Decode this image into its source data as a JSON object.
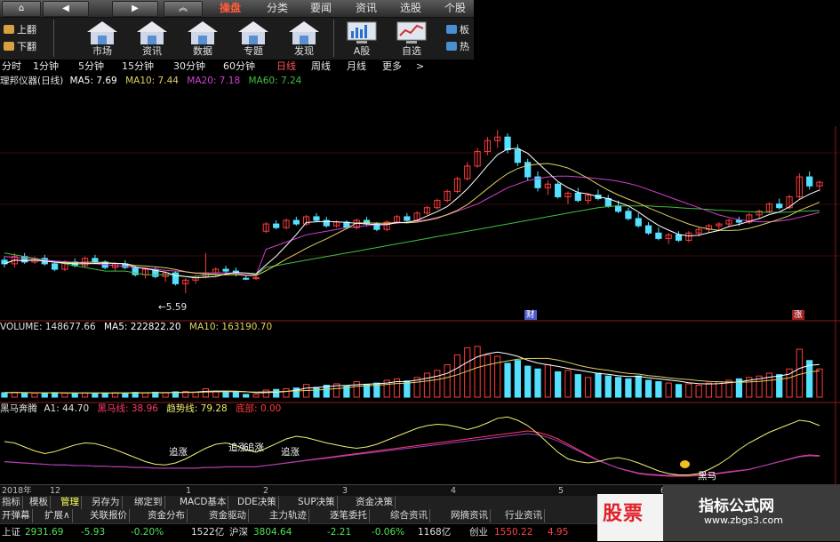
{
  "colors": {
    "up": "#ff3b3b",
    "down": "#55e0ff",
    "ma5": "#ffffff",
    "ma10": "#e0d060",
    "ma20": "#d040d0",
    "ma60": "#40c040",
    "yellow": "#f0f070",
    "brand": "#e0202a"
  },
  "nav": {
    "home_icon": "house-icon",
    "back_icon": "triangle-left-icon",
    "forward_icon": "triangle-right-icon",
    "up_icon": "double-chevron-up-icon"
  },
  "menu": [
    {
      "label": "操盘",
      "active": true
    },
    {
      "label": "分类"
    },
    {
      "label": "要闻"
    },
    {
      "label": "资讯"
    },
    {
      "label": "选股"
    },
    {
      "label": "个股"
    }
  ],
  "paging": {
    "prev": "上翻",
    "next": "下翻"
  },
  "tools": [
    "市场",
    "资讯",
    "数据",
    "专题",
    "发现",
    "A股",
    "自选"
  ],
  "side_tools": [
    "板",
    "热"
  ],
  "periods": [
    {
      "label": "分时"
    },
    {
      "label": "1分钟"
    },
    {
      "label": "5分钟"
    },
    {
      "label": "15分钟"
    },
    {
      "label": "30分钟"
    },
    {
      "label": "60分钟"
    },
    {
      "label": "日线",
      "active": true
    },
    {
      "label": "周线"
    },
    {
      "label": "月线"
    },
    {
      "label": "更多"
    },
    {
      "label": ">"
    }
  ],
  "main_readout": {
    "name": "理邦仪器(日线)",
    "ma5": "MA5: 7.69",
    "ma10": "MA10: 7.44",
    "ma20": "MA20: 7.18",
    "ma60": "MA60: 7.24",
    "low_label": "←5.59"
  },
  "volume_readout": {
    "volume": "VOLUME: 148677.66",
    "ma5": "MA5: 222822.20",
    "ma10": "MA10: 163190.70"
  },
  "indicator_readout": {
    "name": "黑马奔腾",
    "a1": "A1: 44.70",
    "hm": "黑马线: 38.96",
    "trend": "趋势线: 79.28",
    "bottom": "底部: 0.00"
  },
  "chart_labels": {
    "zhuizhang": "追涨",
    "heima": "黑马",
    "cai": "财",
    "zhang": "涨"
  },
  "dates": [
    "2018年",
    "12",
    "1",
    "2",
    "3",
    "4",
    "5",
    "6"
  ],
  "tabs_row1": [
    "指标",
    "模板",
    "管理",
    "另存为",
    "绑定到",
    "MACD基本",
    "DDE决策",
    "SUP决策",
    "资金决策"
  ],
  "tabs_row2": [
    "开弹幕",
    "扩展∧",
    "关联报价",
    "资金分布",
    "资金驱动",
    "主力轨迹",
    "逐笔委托",
    "综合资讯",
    "网摘资讯",
    "行业资讯"
  ],
  "status": {
    "sh_label": "上证",
    "sh_value": "2931.69",
    "sh_change": "-5.93",
    "sh_pct": "-0.20%",
    "sh_amount": "1522亿",
    "hs_label": "沪深",
    "hs_value": "3804.64",
    "hs_change": "-2.21",
    "hs_pct": "-0.06%",
    "hs_amount": "1168亿",
    "cy_label": "创业",
    "cy_value": "1550.22",
    "cy_change": "4.95"
  },
  "logo": {
    "text": "股票"
  },
  "watermark": {
    "title": "指标公式网",
    "url": "www.zbgs3.com"
  },
  "chart_data": {
    "type": "candlestick",
    "price_range": [
      5.0,
      10.2
    ],
    "volume_range": [
      0,
      460000
    ],
    "indicator_range": [
      0,
      100
    ],
    "candles": [
      [
        6.5,
        6.6,
        6.3,
        6.4
      ],
      [
        6.4,
        6.7,
        6.3,
        6.6
      ],
      [
        6.6,
        6.7,
        6.4,
        6.45
      ],
      [
        6.45,
        6.6,
        6.4,
        6.55
      ],
      [
        6.55,
        6.65,
        6.35,
        6.4
      ],
      [
        6.4,
        6.45,
        6.2,
        6.25
      ],
      [
        6.25,
        6.5,
        6.2,
        6.45
      ],
      [
        6.45,
        6.55,
        6.3,
        6.35
      ],
      [
        6.35,
        6.6,
        6.3,
        6.55
      ],
      [
        6.55,
        6.65,
        6.4,
        6.45
      ],
      [
        6.45,
        6.5,
        6.25,
        6.3
      ],
      [
        6.3,
        6.45,
        6.2,
        6.4
      ],
      [
        6.4,
        6.5,
        6.25,
        6.3
      ],
      [
        6.3,
        6.35,
        6.05,
        6.1
      ],
      [
        6.1,
        6.3,
        6.0,
        6.25
      ],
      [
        6.25,
        6.3,
        6.0,
        6.05
      ],
      [
        6.05,
        6.2,
        5.9,
        6.15
      ],
      [
        6.15,
        6.2,
        5.8,
        5.85
      ],
      [
        5.85,
        6.0,
        5.59,
        5.95
      ],
      [
        5.95,
        6.1,
        5.85,
        6.05
      ],
      [
        6.05,
        6.7,
        6.0,
        6.15
      ],
      [
        6.15,
        6.3,
        6.05,
        6.25
      ],
      [
        6.25,
        6.35,
        6.1,
        6.2
      ],
      [
        6.2,
        6.3,
        6.05,
        6.15
      ],
      [
        6.0,
        6.1,
        5.95,
        5.98
      ],
      [
        5.99,
        6.05,
        5.95,
        6.02
      ],
      [
        7.3,
        7.55,
        7.25,
        7.5
      ],
      [
        7.5,
        7.6,
        7.35,
        7.4
      ],
      [
        7.4,
        7.65,
        7.35,
        7.6
      ],
      [
        7.6,
        7.7,
        7.45,
        7.5
      ],
      [
        7.5,
        7.75,
        7.45,
        7.7
      ],
      [
        7.7,
        7.8,
        7.55,
        7.6
      ],
      [
        7.6,
        7.7,
        7.4,
        7.45
      ],
      [
        7.45,
        7.6,
        7.4,
        7.55
      ],
      [
        7.55,
        7.6,
        7.35,
        7.4
      ],
      [
        7.4,
        7.65,
        7.35,
        7.6
      ],
      [
        7.6,
        7.7,
        7.45,
        7.5
      ],
      [
        7.5,
        7.55,
        7.3,
        7.35
      ],
      [
        7.35,
        7.6,
        7.3,
        7.55
      ],
      [
        7.55,
        7.75,
        7.5,
        7.7
      ],
      [
        7.7,
        7.8,
        7.55,
        7.6
      ],
      [
        7.6,
        7.85,
        7.55,
        7.8
      ],
      [
        7.8,
        8.0,
        7.75,
        7.95
      ],
      [
        7.95,
        8.2,
        7.9,
        8.15
      ],
      [
        8.15,
        8.45,
        8.1,
        8.4
      ],
      [
        8.4,
        8.8,
        8.35,
        8.75
      ],
      [
        8.75,
        9.2,
        8.7,
        9.1
      ],
      [
        9.1,
        9.6,
        9.05,
        9.5
      ],
      [
        9.5,
        9.9,
        9.4,
        9.8
      ],
      [
        9.8,
        10.1,
        9.6,
        9.9
      ],
      [
        9.9,
        10.0,
        9.45,
        9.55
      ],
      [
        9.55,
        9.7,
        9.1,
        9.2
      ],
      [
        9.2,
        9.3,
        8.7,
        8.8
      ],
      [
        8.8,
        8.95,
        8.4,
        8.5
      ],
      [
        8.5,
        8.7,
        8.3,
        8.6
      ],
      [
        8.6,
        8.65,
        8.2,
        8.25
      ],
      [
        8.25,
        8.4,
        8.05,
        8.35
      ],
      [
        8.35,
        8.5,
        8.1,
        8.15
      ],
      [
        8.15,
        8.35,
        8.05,
        8.3
      ],
      [
        8.3,
        8.45,
        8.15,
        8.2
      ],
      [
        8.2,
        8.3,
        7.95,
        8.0
      ],
      [
        8.0,
        8.15,
        7.8,
        7.85
      ],
      [
        7.85,
        7.95,
        7.6,
        7.65
      ],
      [
        7.65,
        7.8,
        7.4,
        7.45
      ],
      [
        7.45,
        7.55,
        7.2,
        7.25
      ],
      [
        7.25,
        7.4,
        7.05,
        7.1
      ],
      [
        7.1,
        7.25,
        6.95,
        7.2
      ],
      [
        7.2,
        7.3,
        7.0,
        7.05
      ],
      [
        7.05,
        7.3,
        7.0,
        7.25
      ],
      [
        7.25,
        7.4,
        7.15,
        7.35
      ],
      [
        7.35,
        7.5,
        7.25,
        7.45
      ],
      [
        7.45,
        7.55,
        7.3,
        7.5
      ],
      [
        7.5,
        7.65,
        7.4,
        7.6
      ],
      [
        7.6,
        7.7,
        7.45,
        7.55
      ],
      [
        7.55,
        7.8,
        7.5,
        7.75
      ],
      [
        7.75,
        7.9,
        7.65,
        7.85
      ],
      [
        7.85,
        8.1,
        7.8,
        8.05
      ],
      [
        8.05,
        8.2,
        7.9,
        7.95
      ],
      [
        7.95,
        8.3,
        7.9,
        8.25
      ],
      [
        8.25,
        8.9,
        8.2,
        8.8
      ],
      [
        8.8,
        8.95,
        8.45,
        8.55
      ],
      [
        8.55,
        8.7,
        8.4,
        8.65
      ]
    ],
    "volumes": [
      32000,
      35000,
      30000,
      28000,
      30000,
      33000,
      29000,
      27000,
      31000,
      28000,
      30000,
      32000,
      29000,
      34000,
      31000,
      35000,
      33000,
      38000,
      40000,
      36000,
      60000,
      42000,
      38000,
      35000,
      20000,
      18000,
      50000,
      55000,
      60000,
      65000,
      90000,
      70000,
      85000,
      95000,
      80000,
      110000,
      90000,
      100000,
      120000,
      130000,
      115000,
      140000,
      170000,
      190000,
      230000,
      300000,
      350000,
      360000,
      300000,
      290000,
      240000,
      260000,
      220000,
      200000,
      230000,
      180000,
      190000,
      160000,
      140000,
      170000,
      150000,
      140000,
      130000,
      150000,
      120000,
      110000,
      100000,
      90000,
      95000,
      85000,
      100000,
      110000,
      120000,
      130000,
      140000,
      150000,
      170000,
      160000,
      200000,
      340000,
      260000,
      200000
    ],
    "ma60": [
      6.7,
      6.65,
      6.6,
      6.55,
      6.5,
      6.45,
      6.4,
      6.35,
      6.3,
      6.25,
      6.2,
      6.2,
      6.2,
      6.15,
      6.1,
      6.1,
      6.1,
      6.1,
      6.05,
      6.05,
      6.1,
      6.1,
      6.1,
      6.1,
      6.1,
      6.1,
      6.3,
      6.35,
      6.4,
      6.45,
      6.5,
      6.55,
      6.6,
      6.65,
      6.7,
      6.75,
      6.8,
      6.85,
      6.9,
      6.95,
      7.0,
      7.05,
      7.1,
      7.15,
      7.2,
      7.25,
      7.3,
      7.35,
      7.4,
      7.45,
      7.5,
      7.55,
      7.6,
      7.65,
      7.7,
      7.75,
      7.8,
      7.85,
      7.9,
      7.95,
      7.98,
      8.0,
      8.0,
      8.0,
      8.0,
      7.98,
      7.97,
      7.95,
      7.93,
      7.92,
      7.9,
      7.88,
      7.87,
      7.85,
      7.84,
      7.83,
      7.82,
      7.82,
      7.83,
      7.85,
      7.86,
      7.87
    ],
    "ma20": [
      6.6,
      6.58,
      6.55,
      6.52,
      6.5,
      6.48,
      6.46,
      6.44,
      6.42,
      6.4,
      6.38,
      6.35,
      6.33,
      6.3,
      6.28,
      6.25,
      6.22,
      6.2,
      6.18,
      6.15,
      6.15,
      6.15,
      6.15,
      6.14,
      6.1,
      6.08,
      6.8,
      6.9,
      7.0,
      7.1,
      7.2,
      7.25,
      7.3,
      7.35,
      7.4,
      7.42,
      7.45,
      7.48,
      7.5,
      7.52,
      7.55,
      7.58,
      7.62,
      7.68,
      7.75,
      7.85,
      7.95,
      8.05,
      8.2,
      8.35,
      8.5,
      8.6,
      8.7,
      8.75,
      8.8,
      8.82,
      8.82,
      8.8,
      8.78,
      8.75,
      8.72,
      8.68,
      8.62,
      8.55,
      8.45,
      8.35,
      8.25,
      8.15,
      8.05,
      7.95,
      7.85,
      7.75,
      7.68,
      7.62,
      7.58,
      7.56,
      7.56,
      7.58,
      7.62,
      7.68,
      7.75,
      7.82
    ],
    "indicator": {
      "trend": [
        60,
        58,
        52,
        46,
        42,
        45,
        50,
        55,
        58,
        57,
        53,
        48,
        42,
        36,
        30,
        26,
        25,
        28,
        34,
        42,
        50,
        56,
        58,
        54,
        48,
        44,
        50,
        57,
        64,
        68,
        66,
        62,
        58,
        55,
        52,
        50,
        52,
        56,
        62,
        68,
        74,
        80,
        84,
        86,
        85,
        82,
        78,
        82,
        88,
        95,
        97,
        92,
        84,
        72,
        58,
        44,
        34,
        30,
        28,
        30,
        34,
        36,
        33,
        28,
        22,
        16,
        12,
        10,
        10,
        12,
        18,
        26,
        36,
        48,
        58,
        66,
        74,
        80,
        86,
        92,
        90,
        84
      ],
      "hm": [
        30,
        29,
        28,
        27,
        26,
        25,
        25,
        24,
        24,
        23,
        23,
        22,
        22,
        21,
        21,
        20,
        20,
        20,
        20,
        20,
        21,
        21,
        22,
        22,
        22,
        22,
        24,
        26,
        28,
        30,
        32,
        34,
        36,
        38,
        40,
        42,
        44,
        46,
        48,
        50,
        52,
        54,
        56,
        58,
        60,
        62,
        64,
        66,
        68,
        70,
        72,
        74,
        76,
        74,
        70,
        64,
        56,
        48,
        40,
        32,
        26,
        20,
        16,
        12,
        10,
        9,
        8,
        8,
        8,
        9,
        10,
        12,
        14,
        16,
        18,
        22,
        26,
        30,
        34,
        38,
        40,
        39
      ]
    }
  }
}
